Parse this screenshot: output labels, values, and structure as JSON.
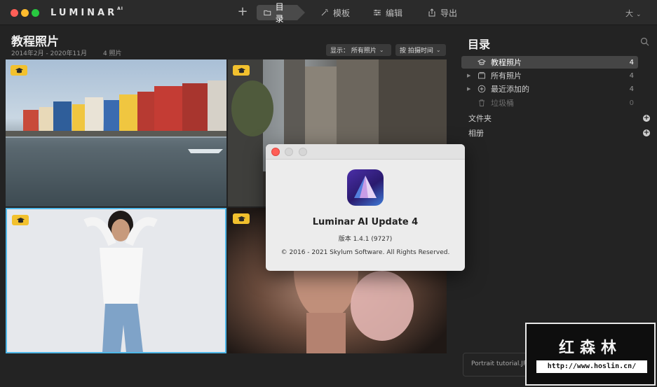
{
  "titlebar": {
    "logo": "LUMINAR",
    "logo_suffix": "AI",
    "tabs": [
      {
        "label": "目录",
        "icon": "folder-icon",
        "active": true
      },
      {
        "label": "模板",
        "icon": "magic-wand-icon",
        "active": false
      },
      {
        "label": "编辑",
        "icon": "sliders-icon",
        "active": false
      },
      {
        "label": "导出",
        "icon": "share-icon",
        "active": false
      }
    ],
    "size_control": "大"
  },
  "gallery": {
    "title": "教程照片",
    "date_range": "2014年2月 - 2020年11月",
    "count": "4 照片",
    "show_filter": "显示： 所有照片",
    "sort": "按 拍摄时间"
  },
  "sidebar": {
    "title": "目录",
    "items": [
      {
        "label": "教程照片",
        "count": "4",
        "icon": "graduation-cap-icon"
      },
      {
        "label": "所有照片",
        "count": "4",
        "icon": "photos-icon"
      },
      {
        "label": "最近添加的",
        "count": "4",
        "icon": "plus-circle-icon"
      },
      {
        "label": "垃圾桶",
        "count": "0",
        "icon": "trash-icon"
      }
    ],
    "folders_label": "文件夹",
    "albums_label": "相册",
    "info_text": "Portrait tutorial.JPG"
  },
  "about_dialog": {
    "app_name": "Luminar AI Update 4",
    "version": "版本 1.4.1 (9727)",
    "copyright": "© 2016 - 2021 Skylum Software. All Rights Reserved."
  },
  "watermark": {
    "title": "红森林",
    "url": "http://www.hoslin.cn/"
  },
  "colors": {
    "background": "#232323",
    "selection_border": "#4fb7e8",
    "badge": "#f2c12e",
    "close_button": "#ff5f57"
  }
}
